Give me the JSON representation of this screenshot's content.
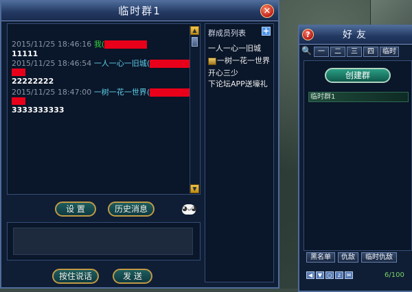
{
  "chat_window": {
    "title": "临时群1",
    "close_icon": "close-icon",
    "messages": [
      {
        "timestamp": "2015/11/25 18:46:16",
        "sender": "我",
        "paren_open": "(",
        "body": "11111"
      },
      {
        "timestamp": "2015/11/25 18:46:54",
        "sender": "一人一心一旧城",
        "paren_open": "(",
        "body": "22222222"
      },
      {
        "timestamp": "2015/11/25 18:47:00",
        "sender": "一树一花一世界",
        "paren_open": "(",
        "body": "3333333333"
      }
    ],
    "member_list_title": "群成员列表",
    "add_icon": "plus-icon",
    "members": [
      "一人一心一旧城",
      "一树一花一世界",
      "开心三少",
      "下论坛APP送壕礼"
    ],
    "settings_label": "设 置",
    "history_label": "历史消息",
    "emoji_icon": "emoji-icon",
    "hold_to_talk_label": "按住说话",
    "send_label": "发 送",
    "input_value": ""
  },
  "friends_window": {
    "title": "好友",
    "help_icon": "help-icon",
    "search_icon": "search-icon",
    "tabs": [
      "一",
      "二",
      "三",
      "四",
      "临时"
    ],
    "create_group_label": "创建群",
    "groups": [
      "临时群1"
    ],
    "bottom_tabs": [
      "黑名单",
      "仇敌",
      "临时仇敌"
    ],
    "count": "6/100"
  },
  "colors": {
    "self_name": "#33d63e",
    "sender_name": "#5fd1ec",
    "redaction": "#e8001a",
    "timestamp": "#8a97a8"
  }
}
